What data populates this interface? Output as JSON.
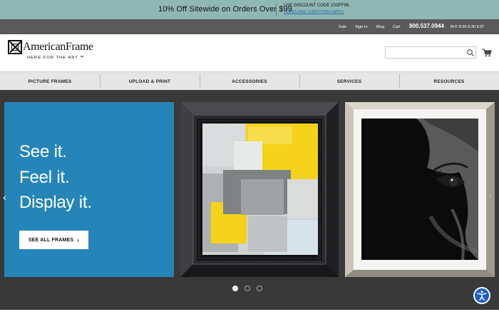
{
  "promo": {
    "main": "10% Off Sitewide on Orders Over $99",
    "code_line": "USE DISCOUNT CODE 10OFF99.",
    "terms": "TERMS AND CONDITIONS APPLY"
  },
  "utility": {
    "sale": "Sale",
    "sign_in": "Sign-In",
    "blog": "Blog",
    "cart": "Cart",
    "phone": "800.537.0944",
    "hours": "M-F 8:30-5:30 EST"
  },
  "brand": {
    "name": "AmericanFrame",
    "tagline": "HERE FOR THE ART.™"
  },
  "search": {
    "placeholder": ""
  },
  "nav": [
    "PICTURE FRAMES",
    "UPLOAD & PRINT",
    "ACCESSORIES",
    "SERVICES",
    "RESOURCES"
  ],
  "hero": {
    "lines": [
      "See it.",
      "Feel it.",
      "Display it."
    ],
    "cta": "SEE ALL FRAMES",
    "cta_chevron": "›",
    "prev_arrow": "‹",
    "next_arrow": "›",
    "active_slide": 1,
    "slide_count": 3
  },
  "colors": {
    "promo_bg": "#8fb8b5",
    "utility_bg": "#5a5a5a",
    "panel_blue": "#2685b8",
    "hero_bg": "#393939",
    "accessibility_blue": "#1a5ec9"
  },
  "icons": [
    "search-icon",
    "cart-icon",
    "accessibility-icon",
    "chevron-left-icon",
    "chevron-right-icon"
  ]
}
